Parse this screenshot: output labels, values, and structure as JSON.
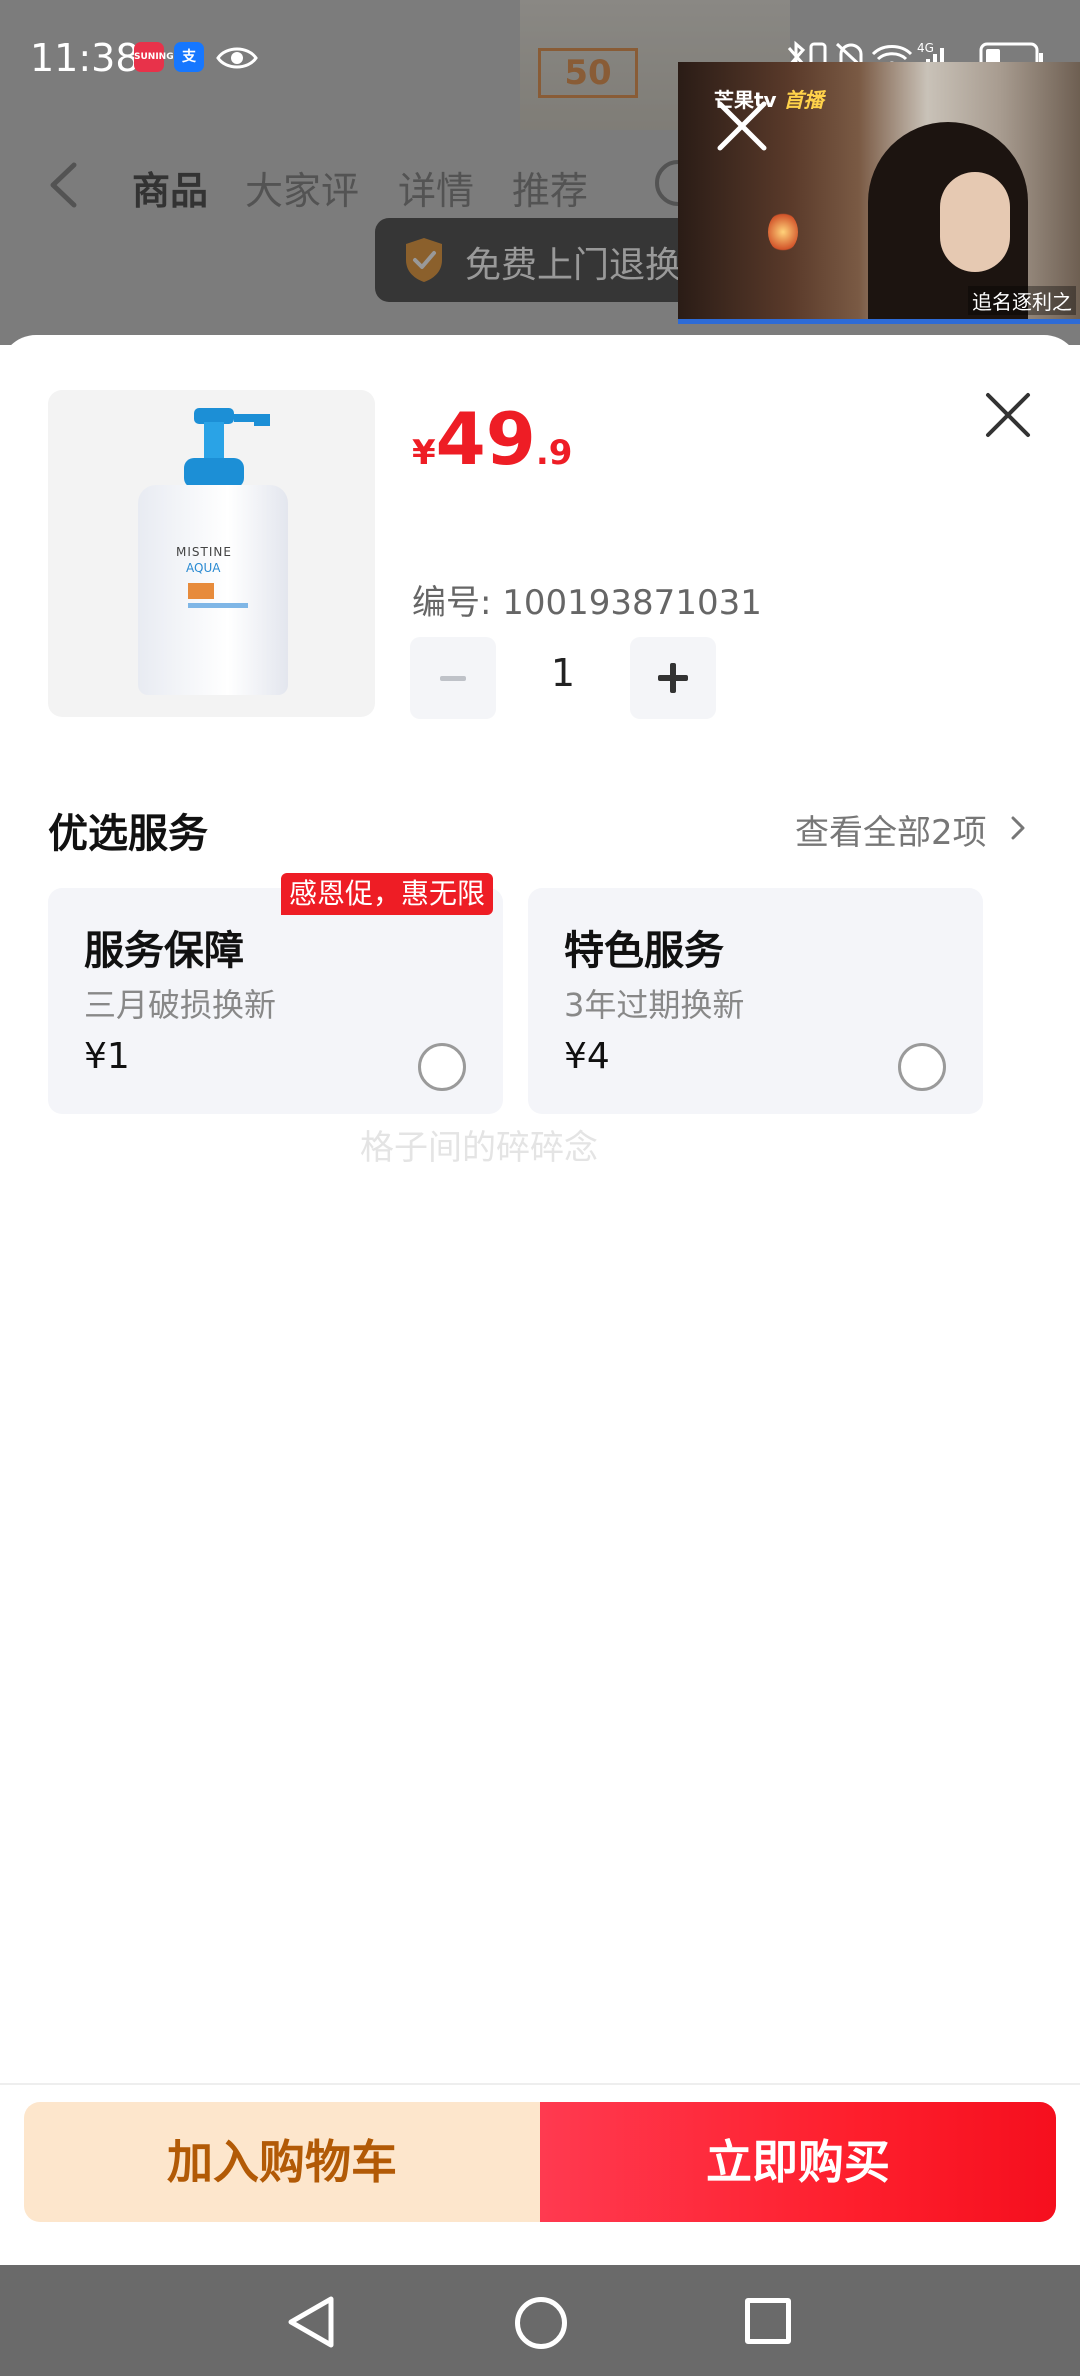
{
  "status_bar": {
    "time": "11:38",
    "apps": [
      {
        "name": "suning-app-icon",
        "label": "SUNING",
        "color": "#e8324a"
      },
      {
        "name": "alipay-app-icon",
        "label": "支",
        "color": "#1677ff"
      }
    ],
    "network": "4G"
  },
  "background_page": {
    "tabs": [
      "商品",
      "大家评",
      "详情",
      "推荐"
    ],
    "active_tab": "商品",
    "banner_spf": "50",
    "ribbon_text": "免费上门退换"
  },
  "floating_video": {
    "brand": "芒果tv",
    "live_label": "首播",
    "caption": "追名逐利之"
  },
  "product": {
    "currency": "¥",
    "price_int": "49",
    "price_dec": ".9",
    "sku_label": "编号: 100193871031",
    "bottle_brand": "MISTINE",
    "bottle_name": "AQUA",
    "quantity": "1"
  },
  "services": {
    "title": "优选服务",
    "view_all": "查看全部2项",
    "items": [
      {
        "name": "服务保障",
        "desc": "三月破损换新",
        "price": "¥1",
        "badge": "感恩促，惠无限"
      },
      {
        "name": "特色服务",
        "desc": "3年过期换新",
        "price": "¥4"
      }
    ]
  },
  "watermark": "格子间的碎碎念",
  "actions": {
    "add_to_cart": "加入购物车",
    "buy_now": "立即购买"
  },
  "colors": {
    "accent_red": "#ee1d25",
    "cart_bg": "#fde6cc",
    "cart_text": "#b25a06"
  }
}
